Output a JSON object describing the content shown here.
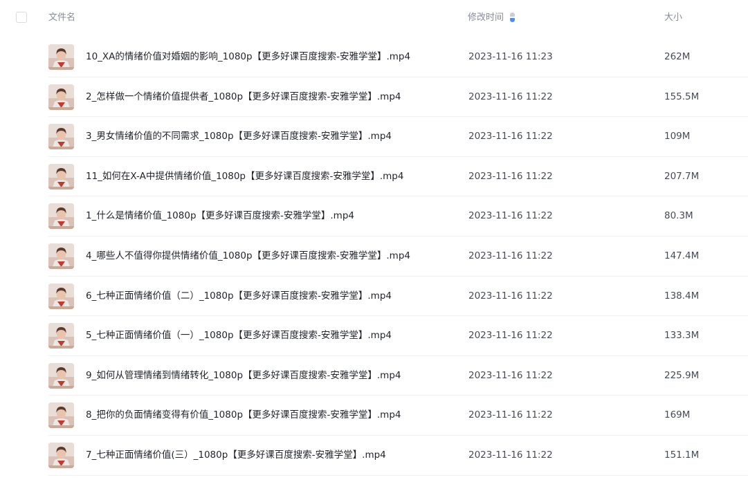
{
  "header": {
    "name_label": "文件名",
    "time_label": "修改时间",
    "size_label": "大小",
    "sort_icon": "sort-desc-icon",
    "sort_active_color": "#4b8bf5"
  },
  "files": [
    {
      "name": "10_XA的情绪价值对婚姻的影响_1080p【更多好课百度搜索-安雅学堂】.mp4",
      "time": "2023-11-16 11:23",
      "size": "262M",
      "thumb_icon": "video-thumbnail"
    },
    {
      "name": "2_怎样做一个情绪价值提供者_1080p【更多好课百度搜索-安雅学堂】.mp4",
      "time": "2023-11-16 11:22",
      "size": "155.5M",
      "thumb_icon": "video-thumbnail"
    },
    {
      "name": "3_男女情绪价值的不同需求_1080p【更多好课百度搜索-安雅学堂】.mp4",
      "time": "2023-11-16 11:22",
      "size": "109M",
      "thumb_icon": "video-thumbnail"
    },
    {
      "name": "11_如何在X-A中提供情绪价值_1080p【更多好课百度搜索-安雅学堂】.mp4",
      "time": "2023-11-16 11:22",
      "size": "207.7M",
      "thumb_icon": "video-thumbnail"
    },
    {
      "name": "1_什么是情绪价值_1080p【更多好课百度搜索-安雅学堂】.mp4",
      "time": "2023-11-16 11:22",
      "size": "80.3M",
      "thumb_icon": "video-thumbnail"
    },
    {
      "name": "4_哪些人不值得你提供情绪价值_1080p【更多好课百度搜索-安雅学堂】.mp4",
      "time": "2023-11-16 11:22",
      "size": "147.4M",
      "thumb_icon": "video-thumbnail"
    },
    {
      "name": "6_七种正面情绪价值（二）_1080p【更多好课百度搜索-安雅学堂】.mp4",
      "time": "2023-11-16 11:22",
      "size": "138.4M",
      "thumb_icon": "video-thumbnail"
    },
    {
      "name": "5_七种正面情绪价值（一）_1080p【更多好课百度搜索-安雅学堂】.mp4",
      "time": "2023-11-16 11:22",
      "size": "133.3M",
      "thumb_icon": "video-thumbnail"
    },
    {
      "name": "9_如何从管理情绪到情绪转化_1080p【更多好课百度搜索-安雅学堂】.mp4",
      "time": "2023-11-16 11:22",
      "size": "225.9M",
      "thumb_icon": "video-thumbnail"
    },
    {
      "name": "8_把你的负面情绪变得有价值_1080p【更多好课百度搜索-安雅学堂】.mp4",
      "time": "2023-11-16 11:22",
      "size": "169M",
      "thumb_icon": "video-thumbnail"
    },
    {
      "name": "7_七种正面情绪价值(三）_1080p【更多好课百度搜索-安雅学堂】.mp4",
      "time": "2023-11-16 11:22",
      "size": "151.1M",
      "thumb_icon": "video-thumbnail"
    }
  ]
}
